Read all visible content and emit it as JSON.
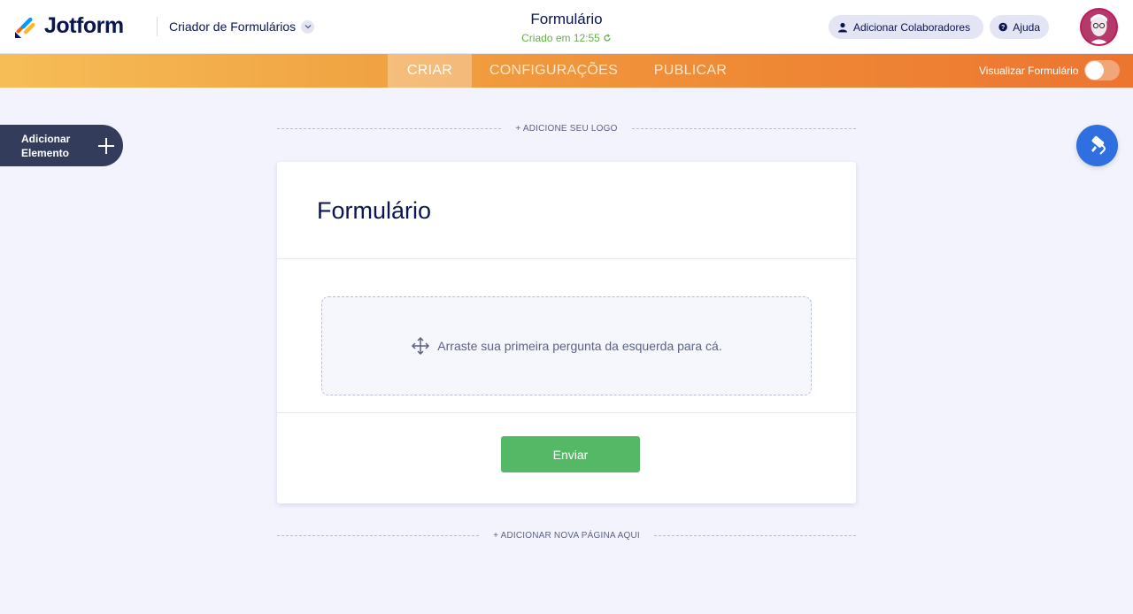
{
  "header": {
    "logo_text": "Jotform",
    "builder_label": "Criador de Formulários",
    "form_title": "Formulário",
    "saved_status": "Criado em 12:55",
    "collaborators_label": "Adicionar Colaboradores",
    "help_label": "Ajuda"
  },
  "nav": {
    "tabs": [
      {
        "label": "CRIAR",
        "active": true
      },
      {
        "label": "CONFIGURAÇÕES",
        "active": false
      },
      {
        "label": "PUBLICAR",
        "active": false
      }
    ],
    "preview_label": "Visualizar Formulário",
    "preview_enabled": false
  },
  "sidebar": {
    "add_element_label": "Adicionar Elemento"
  },
  "form": {
    "add_logo_label": "+ ADICIONE SEU LOGO",
    "title": "Formulário",
    "dropzone_text": "Arraste sua primeira pergunta da esquerda para cá.",
    "submit_label": "Enviar",
    "add_page_label": "+ ADICIONAR NOVA PÁGINA AQUI"
  },
  "colors": {
    "accent_orange": "#ef8a36",
    "submit_green": "#55b867",
    "designer_blue": "#2f6fe0",
    "saved_green": "#64b246",
    "navy": "#0a1551"
  },
  "icons": {
    "logo": "jotform-logo-icon",
    "builder_dropdown": "chevron-down-icon",
    "saved": "refresh-icon",
    "collaborators": "user-icon",
    "help": "question-circle-icon",
    "add_element": "plus-icon",
    "designer": "paint-roller-icon",
    "dropzone": "move-arrows-icon"
  }
}
